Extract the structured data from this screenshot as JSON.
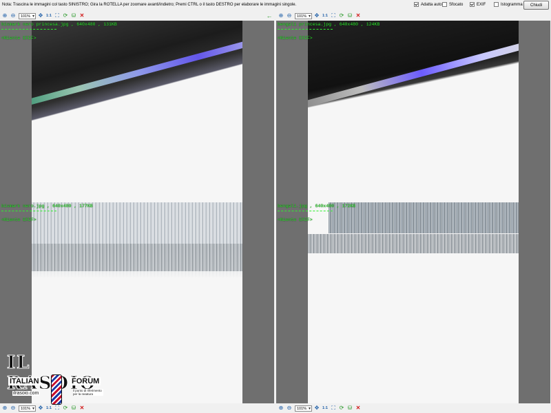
{
  "note": "Nota: Trascina le immagini col tasto SINISTRO; Gira la ROTELLA per zoomare avanti/indietro; Premi CTRL o il tasto DESTRO per elaborare le immagini singole.",
  "options": [
    {
      "label": "Adatta auton",
      "checked": true
    },
    {
      "label": "Sfocato",
      "checked": false
    },
    {
      "label": "EXIF",
      "checked": true
    },
    {
      "label": "Istogramma",
      "checked": false
    }
  ],
  "close_label": "Chiudi",
  "toolbar": {
    "zoom": "101%",
    "one_to_one": "1:1"
  },
  "panels": [
    {
      "info": "bismark nero princesa.jpg , 640x480 , 131KB",
      "exif": "<Niente EXIF>"
    },
    {
      "info": "bengali princesa.jpg , 640x480 , 124KB",
      "exif": "<Niente EXIF>"
    },
    {
      "info": "bismark nero.jpg , 640x480 , 177KB",
      "exif": "<Niente EXIF>"
    },
    {
      "info": "bengali.jpg , 640x480 , 172KB",
      "exif": "<Niente EXIF>"
    }
  ],
  "logo": {
    "title": "IL RASOIO",
    "left": "ITALIAN",
    "right": "FORUM",
    "site": "ilrasoio.com",
    "tagline": "il punto di riferimento per la rasatura"
  },
  "icons": [
    "zoom-in-icon",
    "zoom-out-icon",
    "fit-icon",
    "one-to-one-icon",
    "actual-size-icon",
    "rotate-icon",
    "save-icon",
    "close-red-icon",
    "prev-arrow-icon"
  ]
}
